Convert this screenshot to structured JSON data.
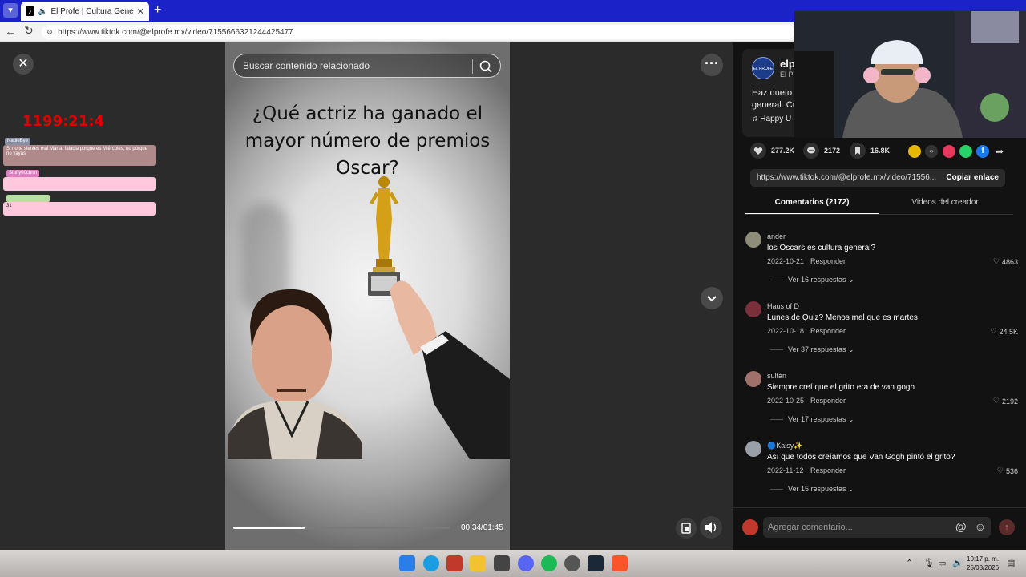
{
  "browser": {
    "tab_title": "El Profe | Cultura General (@e",
    "url": "https://www.tiktok.com/@elprofe.mx/video/7155666321244425477"
  },
  "overlay": {
    "timer": "1199:21:4",
    "chat_user_1": "NadieBye",
    "chat_msg_1": "Si no te sientes mal María, falacia porque es Miércoles, no porque no vayas",
    "chat_user_2": "Stuffy00chrm",
    "chat_msg_3": "31"
  },
  "video": {
    "search_placeholder": "Buscar contenido relacionado",
    "question": "¿Qué actriz ha ganado el mayor número de premios Oscar?",
    "current_time": "00:34",
    "duration": "01:45",
    "time_label": "00:34/01:45",
    "progress": 0.33
  },
  "author": {
    "avatar_text": "EL PROFE",
    "handle": "elp",
    "name": "El Pr",
    "description": "Haz dueto general. Cu",
    "music": "Happy U"
  },
  "stats": {
    "likes": "277.2K",
    "comments": "2172",
    "saves": "16.8K"
  },
  "share": {
    "link": "https://www.tiktok.com/@elprofe.mx/video/71556...",
    "copy_label": "Copiar enlace"
  },
  "tabs": {
    "comments": "Comentarios (2172)",
    "videos": "Videos del creador"
  },
  "comments": [
    {
      "user": "ander",
      "text": "los Oscars es cultura general?",
      "date": "2022-10-21",
      "reply": "Responder",
      "likes": "4863",
      "replies": "Ver 16 respuestas",
      "avatar_color": "#8d8d7a"
    },
    {
      "user": "Haus of D",
      "text": "Lunes de Quiz? Menos mal que es martes",
      "date": "2022-10-18",
      "reply": "Responder",
      "likes": "24.5K",
      "replies": "Ver 37 respuestas",
      "avatar_color": "#7a2f3a"
    },
    {
      "user": "sultán",
      "text": "Siempre creí que el grito era de van gogh",
      "date": "2022-10-25",
      "reply": "Responder",
      "likes": "2192",
      "replies": "Ver 17 respuestas",
      "avatar_color": "#a0706a"
    },
    {
      "user": "🔵Kaisy✨",
      "text": "Así que todos creíamos que Van Gogh pintó el grito?",
      "date": "2022-11-12",
      "reply": "Responder",
      "likes": "536",
      "replies": "Ver 15 respuestas",
      "avatar_color": "#9aa0a8"
    }
  ],
  "comment_input": {
    "placeholder": "Agregar comentario..."
  },
  "taskbar": {
    "time": "10:17 p. m.",
    "date": "25/03/2026"
  }
}
